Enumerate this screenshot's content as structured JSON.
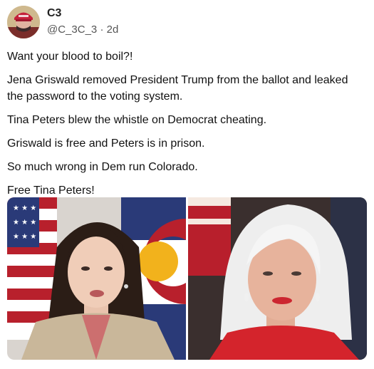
{
  "post": {
    "author_name": "C3",
    "handle": "@C_3C_3",
    "separator": "·",
    "time_ago": "2d",
    "lines": [
      "Want your blood to boil?!",
      "Jena Griswald removed President Trump from the ballot and leaked the password to the voting system.",
      "Tina Peters blew the whistle on Democrat cheating.",
      "Griswald is free and Peters is in prison.",
      "So much wrong in Dem run Colorado.",
      "Free Tina Peters!"
    ],
    "media": [
      {
        "icon": "photo-left-woman-flags"
      },
      {
        "icon": "photo-right-woman-white-hair"
      }
    ]
  },
  "colors": {
    "text": "#111111",
    "muted": "#555555",
    "flag_red": "#b8202c",
    "flag_blue": "#2a3a78",
    "colorado_yellow": "#f2b21c",
    "jacket_red": "#d4242c"
  }
}
